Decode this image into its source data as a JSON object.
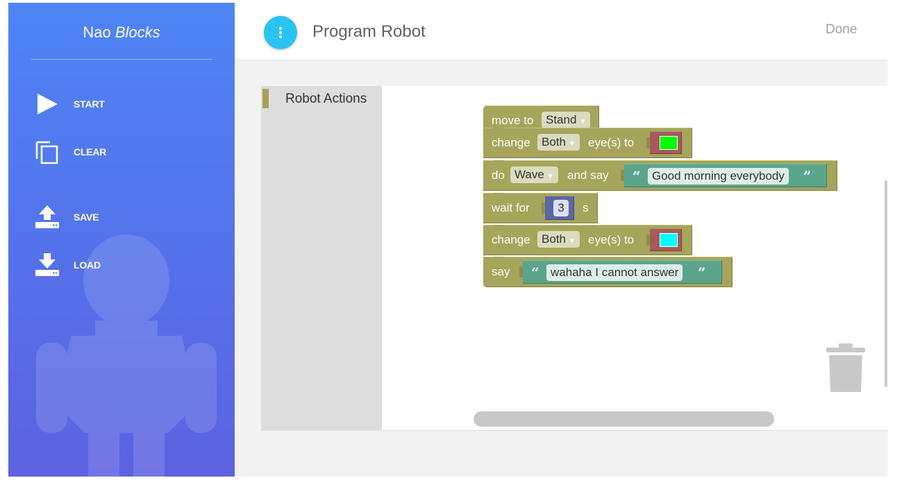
{
  "sidebar": {
    "title_main": "Nao",
    "title_italic": "Blocks",
    "items": [
      {
        "label": "START",
        "icon": "play-icon"
      },
      {
        "label": "CLEAR",
        "icon": "copy-icon"
      },
      {
        "label": "SAVE",
        "icon": "upload-icon"
      },
      {
        "label": "LOAD",
        "icon": "download-icon"
      }
    ]
  },
  "header": {
    "menu_icon": "more-vertical-icon",
    "title": "Program Robot",
    "done_label": "Done",
    "accent_color": "#29c5f0"
  },
  "toolbox": {
    "categories": [
      {
        "label": "Robot Actions",
        "color": "#a5a15a"
      }
    ]
  },
  "program": {
    "move": {
      "prefix": "move to",
      "posture": "Stand"
    },
    "eyes1": {
      "prefix": "change",
      "side": "Both",
      "suffix": "eye(s) to",
      "color": "#00ff00"
    },
    "do_say": {
      "prefix": "do",
      "action": "Wave",
      "middle": "and say",
      "open_quote": "“",
      "text": "Good morning everybody",
      "close_quote": "”"
    },
    "wait": {
      "prefix": "wait for",
      "value": "3",
      "unit": "s"
    },
    "eyes2": {
      "prefix": "change",
      "side": "Both",
      "suffix": "eye(s) to",
      "color": "#00ffff"
    },
    "say": {
      "prefix": "say",
      "open_quote": "“",
      "text": "wahaha I cannot answer",
      "close_quote": "”"
    }
  },
  "colors": {
    "sidebar_gradient_top": "#4e85f5",
    "sidebar_gradient_bottom": "#5d62df",
    "action_block": "#a5a55b",
    "text_block": "#5ba58c",
    "number_block": "#5b67a5",
    "colour_block": "#a55b5b"
  }
}
